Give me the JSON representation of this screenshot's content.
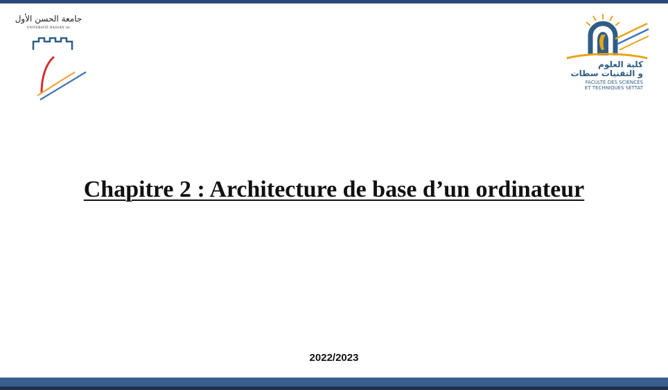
{
  "slide": {
    "title": "Chapitre 2 : Architecture de base d’un ordinateur",
    "year": "2022/2023"
  },
  "logos": {
    "left": {
      "arabic": "جامعة الحسن الأول",
      "latin": "UNIVERSITÉ HASSAN 1er"
    },
    "right": {
      "arabic_line1": "كلية العلوم",
      "arabic_line2": "و التقنيات سطات",
      "latin_line1": "FACULTÉ DES SCIENCES",
      "latin_line2": "ET TECHNIQUES SETTAT"
    }
  },
  "colors": {
    "top_bar": "#2b4a77",
    "bottom_bar": "#3a5f8f",
    "fst_blue": "#2f5d86",
    "fst_gold": "#e8a317"
  }
}
